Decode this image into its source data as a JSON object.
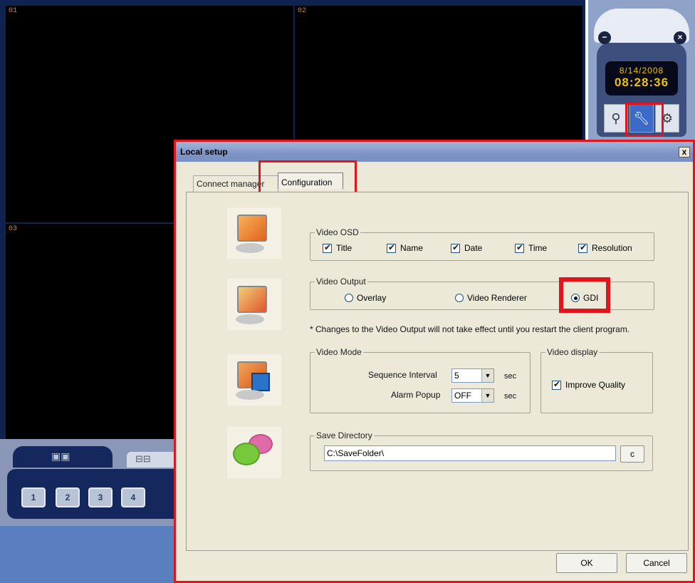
{
  "cameras": [
    {
      "num": "01"
    },
    {
      "num": "02"
    },
    {
      "num": "03"
    }
  ],
  "remote": {
    "minimize_icon": "minus-circle-icon",
    "close_icon": "close-circle-icon",
    "date": "8/14/2008",
    "time": "08:28:36",
    "buttons": [
      "search-icon",
      "wrench-icon",
      "gear-icon"
    ]
  },
  "channel_buttons": [
    "1",
    "2",
    "3",
    "4"
  ],
  "dialog": {
    "title": "Local setup",
    "close": "x",
    "tabs": [
      "Connect manager",
      "Configuration"
    ],
    "video_osd": {
      "label": "Video OSD",
      "options": [
        {
          "label": "Title",
          "checked": true
        },
        {
          "label": "Name",
          "checked": true
        },
        {
          "label": "Date",
          "checked": true
        },
        {
          "label": "Time",
          "checked": true
        },
        {
          "label": "Resolution",
          "checked": true
        }
      ]
    },
    "video_output": {
      "label": "Video Output",
      "options": [
        {
          "label": "Overlay",
          "selected": false
        },
        {
          "label": "Video Renderer",
          "selected": false
        },
        {
          "label": "GDI",
          "selected": true
        }
      ]
    },
    "note": "* Changes to the Video Output will not take effect until you restart the client program.",
    "video_mode": {
      "label": "Video Mode",
      "sequence_label": "Sequence Interval",
      "sequence_value": "5",
      "alarm_label": "Alarm Popup",
      "alarm_value": "OFF",
      "unit": "sec"
    },
    "video_display": {
      "label": "Video display",
      "improve_label": "Improve Quality",
      "improve_checked": true
    },
    "save_directory": {
      "label": "Save Directory",
      "path": "C:\\SaveFolder\\",
      "browse": "c"
    },
    "ok": "OK",
    "cancel": "Cancel"
  }
}
